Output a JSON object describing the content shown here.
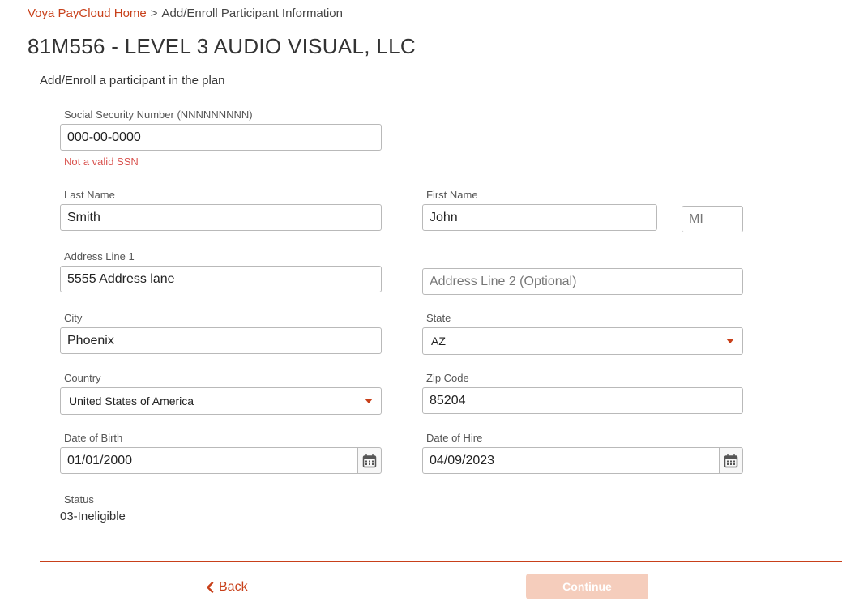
{
  "breadcrumb": {
    "home": "Voya PayCloud Home",
    "separator": ">",
    "current": "Add/Enroll Participant Information"
  },
  "page_title": "81M556 - LEVEL 3 AUDIO VISUAL, LLC",
  "subtitle": "Add/Enroll a participant in the plan",
  "form": {
    "ssn": {
      "label": "Social Security Number (NNNNNNNNN)",
      "value": "000-00-0000",
      "error": "Not a valid SSN"
    },
    "last_name": {
      "label": "Last Name",
      "value": "Smith"
    },
    "first_name": {
      "label": "First Name",
      "value": "John"
    },
    "mi": {
      "placeholder": "MI",
      "value": ""
    },
    "address1": {
      "label": "Address Line 1",
      "value": "5555 Address lane"
    },
    "address2": {
      "placeholder": "Address Line 2 (Optional)",
      "value": ""
    },
    "city": {
      "label": "City",
      "value": "Phoenix"
    },
    "state": {
      "label": "State",
      "value": "AZ"
    },
    "country": {
      "label": "Country",
      "value": "United States of America"
    },
    "zip": {
      "label": "Zip Code",
      "value": "85204"
    },
    "dob": {
      "label": "Date of Birth",
      "value": "01/01/2000"
    },
    "doh": {
      "label": "Date of Hire",
      "value": "04/09/2023"
    },
    "status": {
      "label": "Status",
      "value": "03-Ineligible"
    }
  },
  "footer": {
    "back_label": "Back",
    "continue_label": "Continue"
  },
  "colors": {
    "accent": "#c8401a",
    "error": "#d9534f",
    "continue_disabled": "#f5cdbc"
  },
  "icons": {
    "back": "chevron-left-icon",
    "calendar": "calendar-icon",
    "dropdown": "caret-down-icon"
  }
}
